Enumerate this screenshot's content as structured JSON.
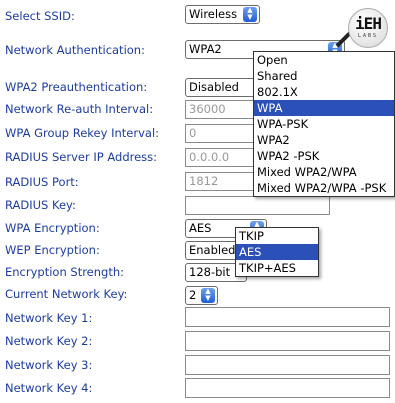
{
  "labels": {
    "ssid": "Select SSID:",
    "auth": "Network Authentication:",
    "preauth": "WPA2 Preauthentication:",
    "reauth": "Network Re-auth Interval:",
    "rekey": "WPA Group Rekey Interval:",
    "radius_ip": "RADIUS Server IP Address:",
    "radius_port": "RADIUS Port:",
    "radius_key": "RADIUS Key:",
    "wpa_enc": "WPA Encryption:",
    "wep_enc": "WEP Encryption:",
    "enc_strength": "Encryption Strength:",
    "current_key": "Current Network Key:",
    "key1": "Network Key 1:",
    "key2": "Network Key 2:",
    "key3": "Network Key 3:",
    "key4": "Network Key 4:"
  },
  "values": {
    "ssid": "Wireless",
    "auth": "WPA2",
    "preauth": "Disabled",
    "reauth": "36000",
    "rekey": "0",
    "radius_ip": "0.0.0.0",
    "radius_port": "1812",
    "radius_key": "",
    "wpa_enc": "AES",
    "wep_enc": "Enabled",
    "enc_strength": "128-bit",
    "current_key": "2",
    "key1": "",
    "key2": "",
    "key3": "",
    "key4": ""
  },
  "auth_menu": {
    "options": [
      "Open",
      "Shared",
      "802.1X",
      "WPA",
      "WPA-PSK",
      "WPA2",
      "WPA2 -PSK",
      "Mixed WPA2/WPA",
      "Mixed WPA2/WPA -PSK"
    ],
    "highlighted": "WPA"
  },
  "enc_menu": {
    "options": [
      "TKIP",
      "AES",
      "TKIP+AES"
    ],
    "highlighted": "AES"
  },
  "logo": {
    "main": "iEH",
    "sub": "LABS"
  },
  "colors": {
    "label": "#1c3da0",
    "highlight": "#2b50b8",
    "arrow_top": "#6fa0ee",
    "arrow_bottom": "#1f5fd4"
  }
}
